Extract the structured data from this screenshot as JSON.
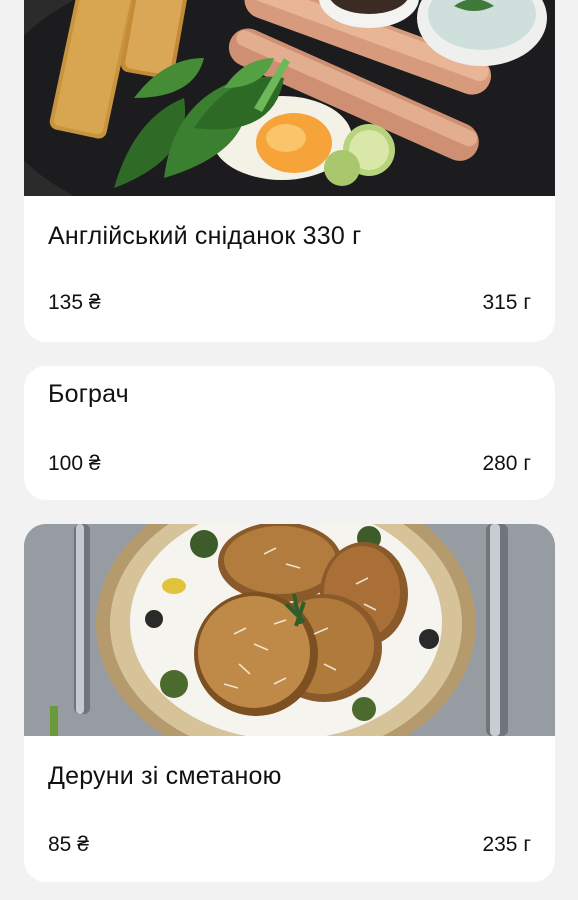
{
  "menu": {
    "items": [
      {
        "title": "Англійський сніданок 330 г",
        "price": "135 ₴",
        "weight": "315 г",
        "photo": "english-breakfast-photo"
      },
      {
        "title": "Бограч",
        "price": "100 ₴",
        "weight": "280 г"
      },
      {
        "title": "Деруни зі сметаною",
        "price": "85 ₴",
        "weight": "235 г",
        "photo": "potato-pancakes-photo"
      }
    ]
  },
  "colors": {
    "background": "#f2f2f2",
    "card": "#ffffff",
    "text": "#111111"
  }
}
